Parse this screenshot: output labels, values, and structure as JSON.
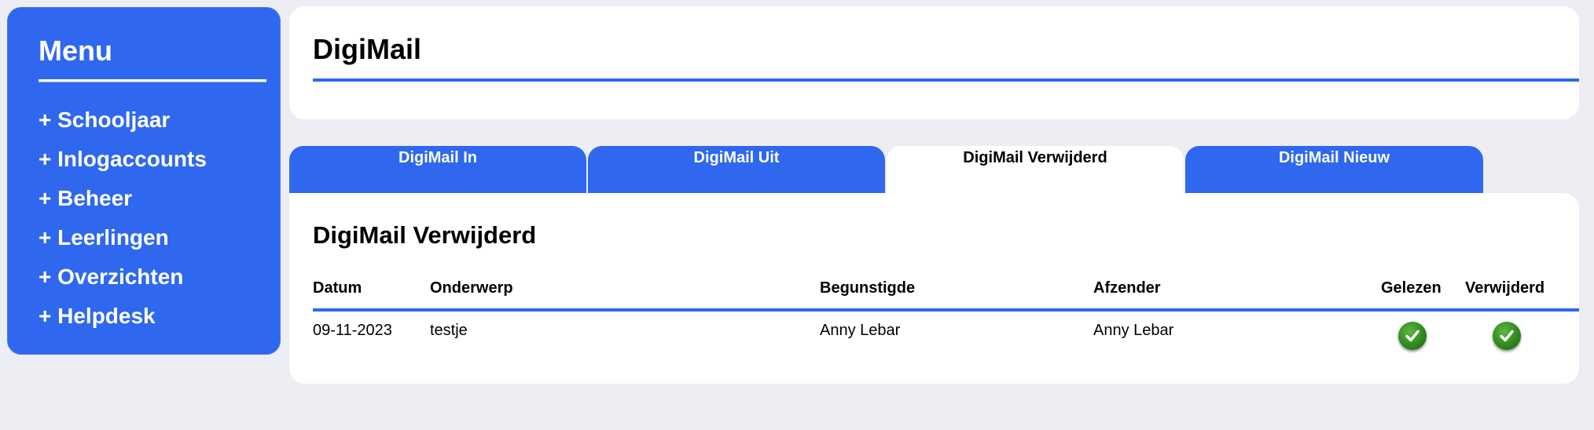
{
  "sidebar": {
    "title": "Menu",
    "items": [
      {
        "label": "+ Schooljaar"
      },
      {
        "label": "+ Inlogaccounts"
      },
      {
        "label": "+ Beheer"
      },
      {
        "label": "+ Leerlingen"
      },
      {
        "label": "+ Overzichten"
      },
      {
        "label": "+ Helpdesk"
      }
    ]
  },
  "header": {
    "title": "DigiMail"
  },
  "tabs": [
    {
      "label": "DigiMail In"
    },
    {
      "label": "DigiMail Uit"
    },
    {
      "label": "DigiMail Verwijderd",
      "active": true
    },
    {
      "label": "DigiMail Nieuw"
    }
  ],
  "content": {
    "title": "DigiMail Verwijderd",
    "columns": [
      "Datum",
      "Onderwerp",
      "Begunstigde",
      "Afzender",
      "Gelezen",
      "Verwijderd"
    ],
    "rows": [
      {
        "datum": "09-11-2023",
        "onderwerp": "testje",
        "begunstigde": "Anny Lebar",
        "afzender": "Anny Lebar",
        "gelezen": "check-icon",
        "verwijderd": "check-icon"
      }
    ]
  },
  "colors": {
    "accent": "#2f68ee",
    "background": "#eceef3",
    "check": "#2f8a1f"
  }
}
